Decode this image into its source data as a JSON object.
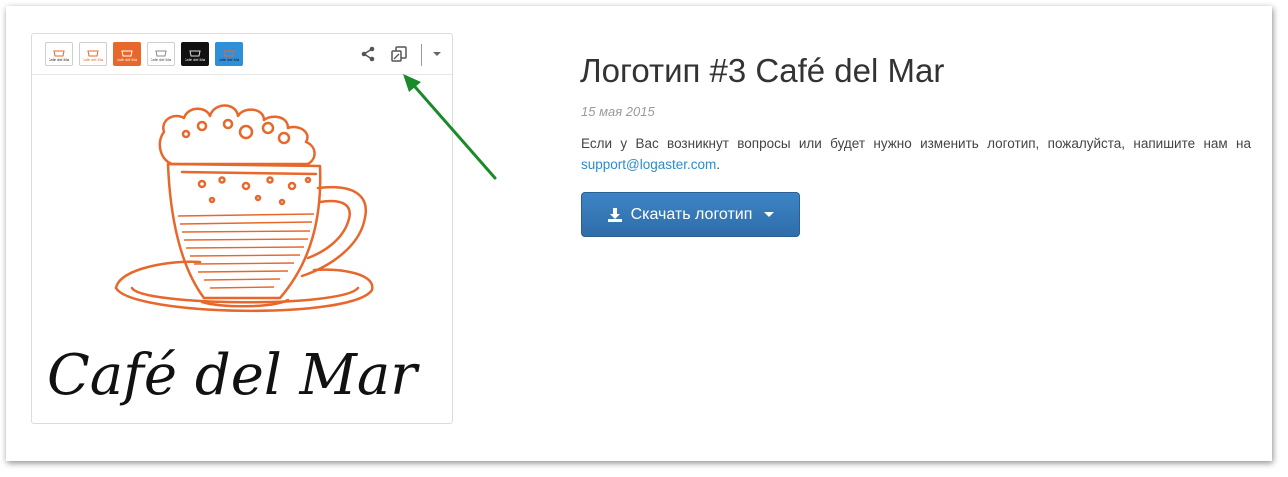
{
  "logo": {
    "title": "Логотип #3 Café del Mar",
    "date": "15 мая 2015",
    "description": "Если у Вас возникнут вопросы или будет нужно изменить логотип, пожалуйста, напишите нам на",
    "email": "support@logaster.com",
    "email_suffix": ".",
    "download_label": "Скачать логотип",
    "wordmark": "Café del Mar"
  },
  "variants": [
    {
      "name": "white-bg",
      "color": "#ffffff"
    },
    {
      "name": "white-bg-orange",
      "color": "#ffffff"
    },
    {
      "name": "orange-bg",
      "color": "#e8672a"
    },
    {
      "name": "white-bg-gray",
      "color": "#ffffff"
    },
    {
      "name": "black-bg",
      "color": "#111111"
    },
    {
      "name": "blue-bg",
      "color": "#2f8fd8"
    }
  ],
  "toolbar": {
    "share_icon": "share-icon",
    "copy_icon": "copy-icon",
    "dropdown_icon": "chevron-down-icon"
  },
  "colors": {
    "accent": "#e8672a",
    "button": "#337ab7",
    "link": "#2a8ccd",
    "annotation_arrow": "#1a8a2a"
  }
}
